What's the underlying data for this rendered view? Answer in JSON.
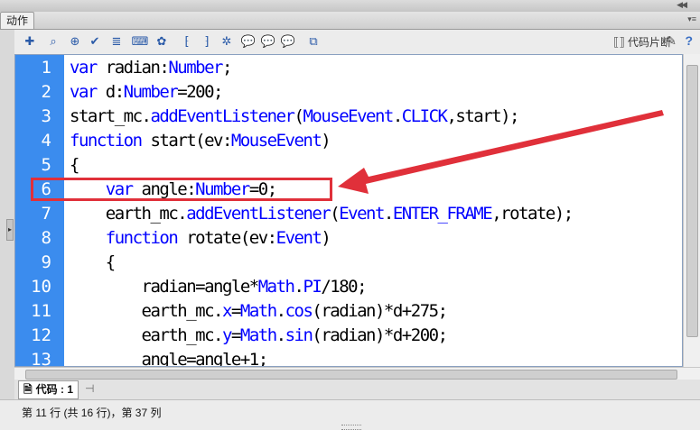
{
  "panel": {
    "tab_label": "动作",
    "collapse_icon": "double-chevron-right-icon",
    "menu_icon": "panel-menu-icon"
  },
  "toolbar": {
    "buttons": [
      {
        "icon": "add-statement-icon",
        "glyph": "✚"
      },
      {
        "icon": "find-icon",
        "glyph": "⌕"
      },
      {
        "icon": "target-path-icon",
        "glyph": "⊕"
      },
      {
        "icon": "check-syntax-icon",
        "glyph": "✔"
      },
      {
        "icon": "auto-format-icon",
        "glyph": "≣"
      },
      {
        "icon": "code-hint-icon",
        "glyph": "⌨"
      },
      {
        "icon": "debug-options-icon",
        "glyph": "✿"
      },
      {
        "icon": "collapse-between-braces-icon",
        "glyph": "⁅"
      },
      {
        "icon": "collapse-selection-icon",
        "glyph": "⁆"
      },
      {
        "icon": "expand-all-icon",
        "glyph": "✲"
      },
      {
        "icon": "apply-block-comment-icon",
        "glyph": "💬"
      },
      {
        "icon": "apply-line-comment-icon",
        "glyph": "💬"
      },
      {
        "icon": "remove-comment-icon",
        "glyph": "💬"
      },
      {
        "icon": "show-hide-toolbox-icon",
        "glyph": "⧉"
      }
    ],
    "snippets_label": "代码片断",
    "snippets_icon": "code-snippets-icon",
    "wand_icon": "wand-icon",
    "help_icon": "help-icon"
  },
  "code_lines": [
    {
      "num": "1",
      "html": "<span class=\"kw\">var</span> radian:<span class=\"ty\">Number</span>;"
    },
    {
      "num": "2",
      "html": "<span class=\"kw\">var</span> d:<span class=\"ty\">Number</span>=200;"
    },
    {
      "num": "3",
      "html": "start_mc.<span class=\"ty\">addEventListener</span>(<span class=\"ty\">MouseEvent</span>.<span class=\"ty\">CLICK</span>,start);"
    },
    {
      "num": "4",
      "html": "<span class=\"kw\">function</span> start(ev:<span class=\"ty\">MouseEvent</span>)"
    },
    {
      "num": "5",
      "html": "{"
    },
    {
      "num": "6",
      "html": "    <span class=\"kw\">var</span> angle:<span class=\"ty\">Number</span>=0;"
    },
    {
      "num": "7",
      "html": "    earth_mc.<span class=\"ty\">addEventListener</span>(<span class=\"ty\">Event</span>.<span class=\"ty\">ENTER_FRAME</span>,rotate);"
    },
    {
      "num": "8",
      "html": "    <span class=\"kw\">function</span> rotate(ev:<span class=\"ty\">Event</span>)"
    },
    {
      "num": "9",
      "html": "    {"
    },
    {
      "num": "10",
      "html": "        radian=angle*<span class=\"ty\">Math</span>.<span class=\"ty\">PI</span>/180;"
    },
    {
      "num": "11",
      "html": "        earth_mc.<span class=\"ty\">x</span>=<span class=\"ty\">Math</span>.<span class=\"ty\">cos</span>(radian)*d+275;"
    },
    {
      "num": "12",
      "html": "        earth_mc.<span class=\"ty\">y</span>=<span class=\"ty\">Math</span>.<span class=\"ty\">sin</span>(radian)*d+200;"
    },
    {
      "num": "13",
      "html": "        angle=angle+1;"
    }
  ],
  "script_tab": {
    "label": "代码 : 1",
    "icon": "script-file-icon",
    "pin_icon": "pin-script-icon"
  },
  "status": {
    "text": "第 11 行 (共 16 行)，第 37 列"
  },
  "colors": {
    "gutter": "#3b8cee",
    "keyword": "#0000ff",
    "annotation": "#e0303a"
  }
}
